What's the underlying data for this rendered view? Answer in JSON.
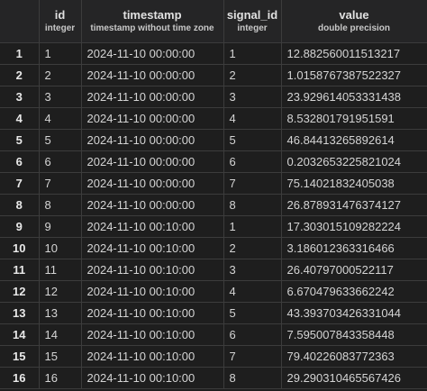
{
  "columns": [
    {
      "name": "id",
      "type": "integer"
    },
    {
      "name": "timestamp",
      "type": "timestamp without time zone"
    },
    {
      "name": "signal_id",
      "type": "integer"
    },
    {
      "name": "value",
      "type": "double precision"
    }
  ],
  "rows": [
    {
      "n": "1",
      "id": "1",
      "timestamp": "2024-11-10 00:00:00",
      "signal_id": "1",
      "value": "12.882560011513217"
    },
    {
      "n": "2",
      "id": "2",
      "timestamp": "2024-11-10 00:00:00",
      "signal_id": "2",
      "value": "1.0158767387522327"
    },
    {
      "n": "3",
      "id": "3",
      "timestamp": "2024-11-10 00:00:00",
      "signal_id": "3",
      "value": "23.929614053331438"
    },
    {
      "n": "4",
      "id": "4",
      "timestamp": "2024-11-10 00:00:00",
      "signal_id": "4",
      "value": "8.532801791951591"
    },
    {
      "n": "5",
      "id": "5",
      "timestamp": "2024-11-10 00:00:00",
      "signal_id": "5",
      "value": "46.84413265892614"
    },
    {
      "n": "6",
      "id": "6",
      "timestamp": "2024-11-10 00:00:00",
      "signal_id": "6",
      "value": "0.2032653225821024"
    },
    {
      "n": "7",
      "id": "7",
      "timestamp": "2024-11-10 00:00:00",
      "signal_id": "7",
      "value": "75.14021832405038"
    },
    {
      "n": "8",
      "id": "8",
      "timestamp": "2024-11-10 00:00:00",
      "signal_id": "8",
      "value": "26.878931476374127"
    },
    {
      "n": "9",
      "id": "9",
      "timestamp": "2024-11-10 00:10:00",
      "signal_id": "1",
      "value": "17.303015109282224"
    },
    {
      "n": "10",
      "id": "10",
      "timestamp": "2024-11-10 00:10:00",
      "signal_id": "2",
      "value": "3.186012363316466"
    },
    {
      "n": "11",
      "id": "11",
      "timestamp": "2024-11-10 00:10:00",
      "signal_id": "3",
      "value": "26.40797000522117"
    },
    {
      "n": "12",
      "id": "12",
      "timestamp": "2024-11-10 00:10:00",
      "signal_id": "4",
      "value": "6.670479633662242"
    },
    {
      "n": "13",
      "id": "13",
      "timestamp": "2024-11-10 00:10:00",
      "signal_id": "5",
      "value": "43.393703426331044"
    },
    {
      "n": "14",
      "id": "14",
      "timestamp": "2024-11-10 00:10:00",
      "signal_id": "6",
      "value": "7.595007843358448"
    },
    {
      "n": "15",
      "id": "15",
      "timestamp": "2024-11-10 00:10:00",
      "signal_id": "7",
      "value": "79.40226083772363"
    },
    {
      "n": "16",
      "id": "16",
      "timestamp": "2024-11-10 00:10:00",
      "signal_id": "8",
      "value": "29.290310465567426"
    }
  ]
}
